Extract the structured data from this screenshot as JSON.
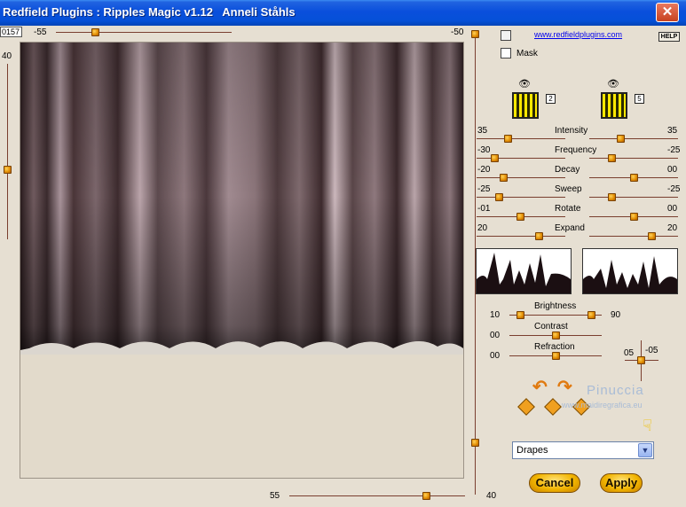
{
  "window": {
    "title": "Redfield Plugins : Ripples Magic v1.12   Anneli Ståhls",
    "close_glyph": "✕"
  },
  "top_slider": {
    "value_box": "0157",
    "left_label": "-55",
    "right_label": "-50",
    "value_fraction": 0.22
  },
  "left_slider": {
    "label": "40",
    "value_fraction": 0.6
  },
  "bottom_slider": {
    "left_label": "55",
    "right_label": "40",
    "value_fraction": 0.78
  },
  "right_vertical_slider": {
    "value_fraction": 0.0
  },
  "header_links": {
    "website": "www.redfieldplugins.com",
    "help": "HELP"
  },
  "mask": {
    "label": "Mask",
    "checked": false
  },
  "layers": [
    {
      "number": "2",
      "icon": "eye-icon"
    },
    {
      "number": "5",
      "icon": "eye-icon"
    }
  ],
  "params": [
    {
      "name": "Intensity",
      "left_value": "35",
      "right_value": "35",
      "left_fraction": 0.35,
      "right_fraction": 0.35
    },
    {
      "name": "Frequency",
      "left_value": "-30",
      "right_value": "-25",
      "left_fraction": 0.2,
      "right_fraction": 0.25
    },
    {
      "name": "Decay",
      "left_value": "-20",
      "right_value": "00",
      "left_fraction": 0.3,
      "right_fraction": 0.5
    },
    {
      "name": "Sweep",
      "left_value": "-25",
      "right_value": "-25",
      "left_fraction": 0.25,
      "right_fraction": 0.25
    },
    {
      "name": "Rotate",
      "left_value": "-01",
      "right_value": "00",
      "left_fraction": 0.49,
      "right_fraction": 0.5
    },
    {
      "name": "Expand",
      "left_value": "20",
      "right_value": "20",
      "left_fraction": 0.7,
      "right_fraction": 0.7
    }
  ],
  "brightness": {
    "label": "Brightness",
    "left_value": "10",
    "right_value": "90",
    "left_fraction": 0.1,
    "right_fraction": 0.9
  },
  "contrast": {
    "label": "Contrast",
    "value": "00",
    "fraction": 0.5
  },
  "refraction": {
    "label": "Refraction",
    "value": "00",
    "fraction": 0.5
  },
  "offset": {
    "x_label": "05",
    "y_label": "-05"
  },
  "watermark": {
    "name": "Pinuccia",
    "url": "www.maidiregrafica.eu"
  },
  "preset": {
    "selected": "Drapes"
  },
  "buttons": {
    "cancel": "Cancel",
    "apply": "Apply"
  },
  "colors": {
    "title_bar": "#0550d8",
    "accent": "#f1b400",
    "track": "#7a3f2f",
    "panel": "#e6dfd2"
  }
}
